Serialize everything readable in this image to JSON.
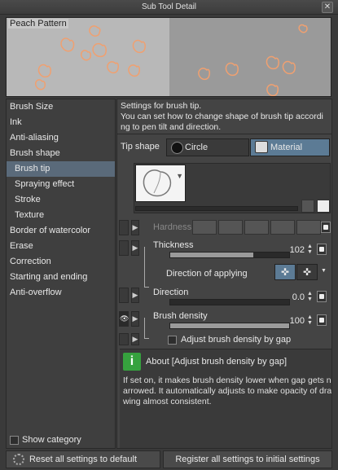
{
  "window": {
    "title": "Sub Tool Detail"
  },
  "preview": {
    "label": "Peach Pattern"
  },
  "categories": [
    {
      "label": "Brush Size"
    },
    {
      "label": "Ink"
    },
    {
      "label": "Anti-aliasing"
    },
    {
      "label": "Brush shape"
    },
    {
      "label": "Brush tip"
    },
    {
      "label": "Spraying effect"
    },
    {
      "label": "Stroke"
    },
    {
      "label": "Texture"
    },
    {
      "label": "Border of watercolor"
    },
    {
      "label": "Erase"
    },
    {
      "label": "Correction"
    },
    {
      "label": "Starting and ending"
    },
    {
      "label": "Anti-overflow"
    }
  ],
  "show_category": {
    "label": "Show category",
    "checked": false
  },
  "description": {
    "line1": "Settings for brush tip.",
    "line2": "You can set how to change shape of brush tip accordi",
    "line3": "ng to pen tilt and direction."
  },
  "tip_shape": {
    "label": "Tip shape",
    "options": [
      "Circle",
      "Material"
    ],
    "selected": "Material"
  },
  "params": {
    "hardness": {
      "label": "Hardness"
    },
    "thickness": {
      "label": "Thickness",
      "value": "102",
      "fraction": 0.7
    },
    "direction_of_applying": {
      "label": "Direction of applying"
    },
    "direction": {
      "label": "Direction",
      "value": "0.0",
      "fraction": 0.0
    },
    "brush_density": {
      "label": "Brush density",
      "value": "100",
      "fraction": 1.0
    },
    "adjust_density": {
      "label": "Adjust brush density by gap",
      "checked": false
    }
  },
  "info": {
    "title": "About [Adjust brush density by gap]",
    "lines": [
      "If set on, it makes brush density lower when gap gets n",
      "arrowed. It automatically adjusts to make opacity of dra",
      "wing almost consistent."
    ]
  },
  "buttons": {
    "reset": "Reset all settings to default",
    "register": "Register all settings to initial settings"
  },
  "colors": {
    "selected_category": "#5a6a7a",
    "material_active": "#5c7b95",
    "info_icon": "#36a23e"
  }
}
